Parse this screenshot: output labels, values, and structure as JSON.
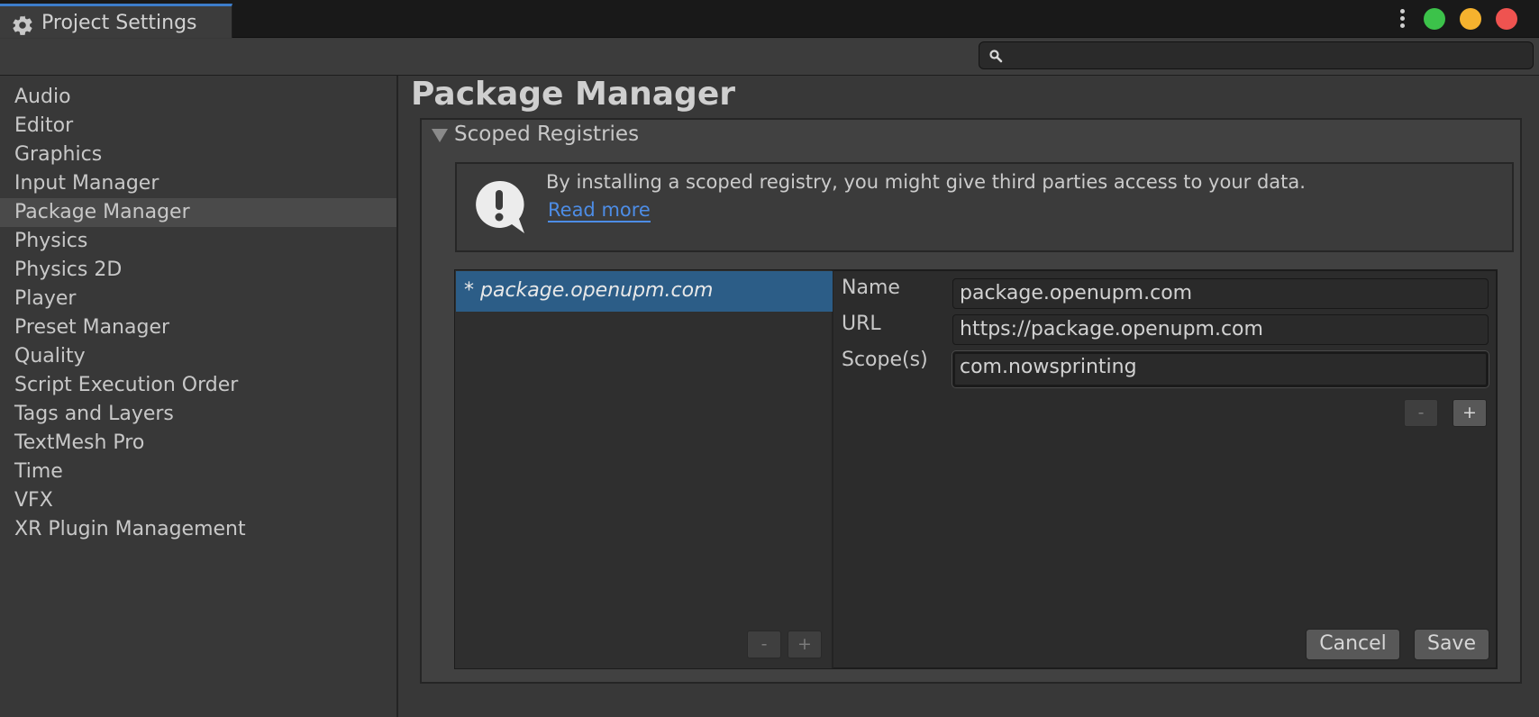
{
  "window": {
    "tab_title": "Project Settings",
    "icons": {
      "tab": "gear-icon",
      "menu": "more-vertical-icon",
      "search": "search-icon"
    },
    "controls": {
      "green": "#3cc24a",
      "yellow": "#f5b22e",
      "red": "#ef5350"
    }
  },
  "search": {
    "value": "",
    "placeholder": ""
  },
  "sidebar": {
    "items": [
      {
        "label": "Audio"
      },
      {
        "label": "Editor"
      },
      {
        "label": "Graphics"
      },
      {
        "label": "Input Manager"
      },
      {
        "label": "Package Manager",
        "selected": true
      },
      {
        "label": "Physics"
      },
      {
        "label": "Physics 2D"
      },
      {
        "label": "Player"
      },
      {
        "label": "Preset Manager"
      },
      {
        "label": "Quality"
      },
      {
        "label": "Script Execution Order"
      },
      {
        "label": "Tags and Layers"
      },
      {
        "label": "TextMesh Pro"
      },
      {
        "label": "Time"
      },
      {
        "label": "VFX"
      },
      {
        "label": "XR Plugin Management"
      }
    ]
  },
  "main": {
    "title": "Package Manager",
    "section": {
      "title": "Scoped Registries",
      "expanded": true,
      "warning": {
        "icon": "exclamation-bubble-icon",
        "text": "By installing a scoped registry, you might give third parties access to your data.",
        "link": "Read more"
      },
      "registry_list": {
        "items": [
          "* package.openupm.com"
        ],
        "selected_index": 0,
        "remove_label": "-",
        "add_label": "+"
      },
      "details": {
        "name_label": "Name",
        "name_value": "package.openupm.com",
        "url_label": "URL",
        "url_value": "https://package.openupm.com",
        "scopes_label": "Scope(s)",
        "scopes": [
          "com.nowsprinting"
        ],
        "scope_remove_label": "-",
        "scope_add_label": "+",
        "cancel_label": "Cancel",
        "save_label": "Save"
      }
    }
  },
  "colors": {
    "accent": "#3d7dcb",
    "selection": "#2c5d87",
    "link": "#4d8de6"
  }
}
